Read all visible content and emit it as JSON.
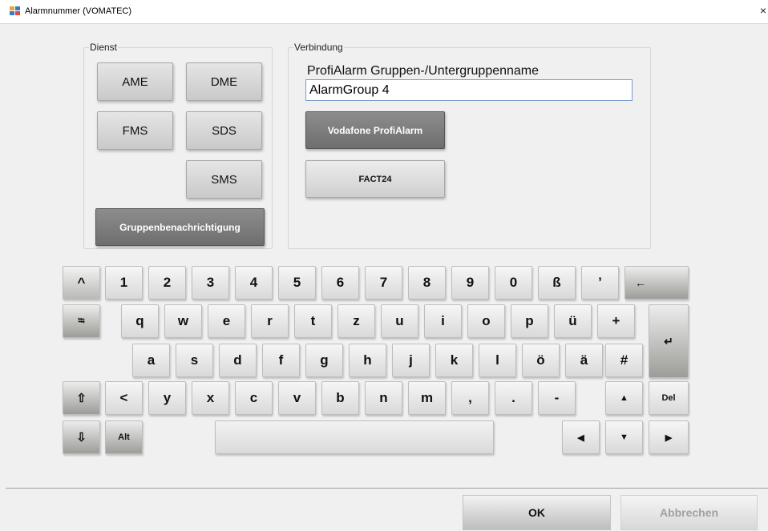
{
  "window": {
    "title": "Alarmnummer (VOMATEC)",
    "close_glyph": "×"
  },
  "dienst": {
    "legend": "Dienst",
    "buttons": {
      "ame": "AME",
      "dme": "DME",
      "fms": "FMS",
      "sds": "SDS",
      "sms": "SMS"
    },
    "group_notification": "Gruppenbenachrichtigung"
  },
  "verbindung": {
    "legend": "Verbindung",
    "group_label": "ProfiAlarm Gruppen-/Untergruppenname",
    "group_value": "AlarmGroup 4",
    "vodafone_label": "Vodafone ProfiAlarm",
    "fact24_label": "FACT24"
  },
  "keyboard": {
    "row1": [
      "^",
      "1",
      "2",
      "3",
      "4",
      "5",
      "6",
      "7",
      "8",
      "9",
      "0",
      "ß",
      "’"
    ],
    "backspace": "←",
    "tab": "⭾",
    "row2": [
      "q",
      "w",
      "e",
      "r",
      "t",
      "z",
      "u",
      "i",
      "o",
      "p",
      "ü",
      "+"
    ],
    "enter": "↵",
    "row3": [
      "a",
      "s",
      "d",
      "f",
      "g",
      "h",
      "j",
      "k",
      "l",
      "ö",
      "ä",
      "#"
    ],
    "shift": "⇧",
    "row4": [
      "<",
      "y",
      "x",
      "c",
      "v",
      "b",
      "n",
      "m",
      ",",
      ".",
      "-"
    ],
    "arrow_up": "▲",
    "del": "Del",
    "caps": "⇩",
    "alt": "Alt",
    "space": "",
    "arrow_left": "◀",
    "arrow_down": "▼",
    "arrow_right": "▶"
  },
  "footer": {
    "ok": "OK",
    "cancel": "Abbrechen"
  },
  "colors": {
    "input_border": "#7a9ec9",
    "dark_button": "#7d7d7d",
    "disabled_text": "#a0a0a0"
  }
}
